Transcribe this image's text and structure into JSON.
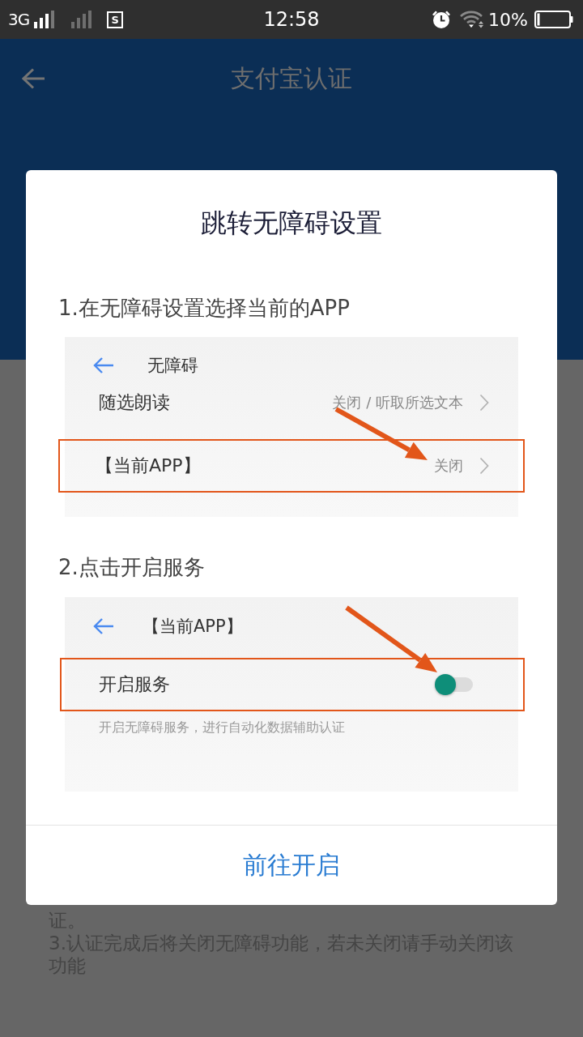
{
  "status_bar": {
    "network": "3G",
    "sim_label": "S",
    "time": "12:58",
    "battery": "10%"
  },
  "app_bar": {
    "title": "支付宝认证"
  },
  "background_text": [
    "证。",
    "3.认证完成后将关闭无障碍功能，若未关闭请手动关闭该功能"
  ],
  "dialog": {
    "title": "跳转无障碍设置",
    "steps": [
      {
        "label": "1.在无障碍设置选择当前的APP",
        "panel": {
          "title": "无障碍",
          "rows": [
            {
              "kind": "link",
              "label": "随选朗读",
              "value": "关闭 / 听取所选文本",
              "highlighted": false
            },
            {
              "kind": "link",
              "label": "【当前APP】",
              "value": "关闭",
              "highlighted": true
            }
          ]
        }
      },
      {
        "label": "2.点击开启服务",
        "panel": {
          "title": "【当前APP】",
          "rows": [
            {
              "kind": "switch",
              "label": "开启服务",
              "on": false,
              "highlighted": true
            }
          ],
          "note": "开启无障碍服务，进行自动化数据辅助认证"
        }
      }
    ],
    "button": "前往开启"
  }
}
